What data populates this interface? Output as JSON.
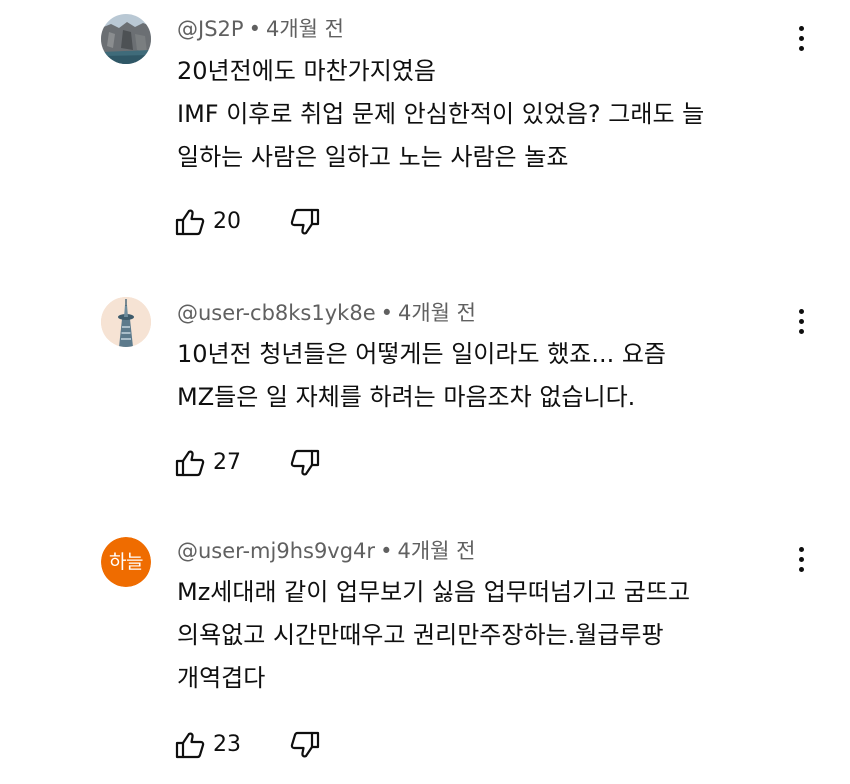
{
  "comments": [
    {
      "author": "@JS2P",
      "separator": "•",
      "time": "4개월 전",
      "lines": [
        "20년전에도 마찬가지였음",
        "IMF 이후로 취업 문제 안심한적이 있었음? 그래도 늘",
        "일하는 사람은 일하고 노는 사람은 놀죠"
      ],
      "likes": "20",
      "avatar_icon": "rock-landscape-avatar-icon"
    },
    {
      "author": "@user-cb8ks1yk8e",
      "separator": "•",
      "time": "4개월 전",
      "lines": [
        "10년전 청년들은 어떻게든 일이라도 했죠... 요즘",
        "MZ들은 일 자체를 하려는 마음조차 없습니다."
      ],
      "likes": "27",
      "avatar_icon": "tower-avatar-icon"
    },
    {
      "author": "@user-mj9hs9vg4r",
      "separator": "•",
      "time": "4개월 전",
      "lines": [
        "Mz세대래 같이 업무보기 싫음 업무떠넘기고 굼뜨고",
        "의욕없고 시간만때우고 권리만주장하는.월급루팡",
        "개역겹다"
      ],
      "likes": "23",
      "avatar_text": "하늘",
      "avatar_color": "#ef6c00"
    }
  ],
  "icons": {
    "like": "thumbs-up-icon",
    "dislike": "thumbs-down-icon",
    "menu": "more-vertical-icon"
  }
}
